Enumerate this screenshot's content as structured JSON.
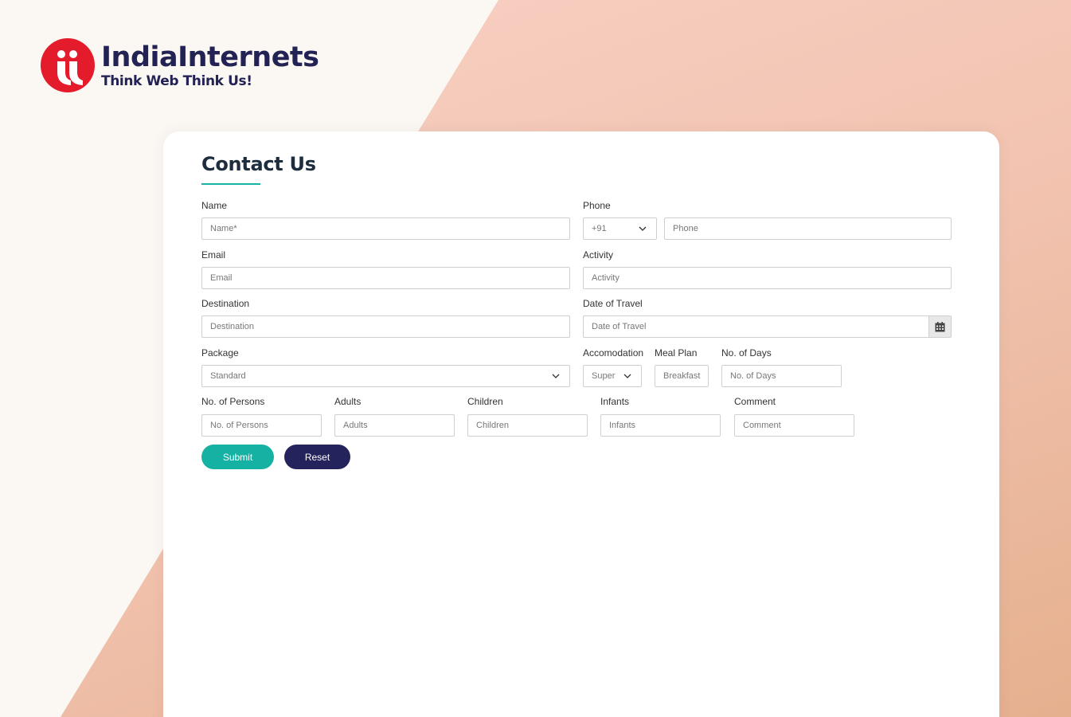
{
  "brand": {
    "name": "IndiaInternets",
    "tagline": "Think Web Think Us!",
    "logo_mark": "ii",
    "colors": {
      "red": "#e31b2b",
      "navy": "#222254",
      "teal": "#17b2a3"
    }
  },
  "form": {
    "title": "Contact Us",
    "name": {
      "label": "Name",
      "placeholder": "Name*"
    },
    "phone": {
      "label": "Phone",
      "code": "+91",
      "placeholder": "Phone"
    },
    "email": {
      "label": "Email",
      "placeholder": "Email"
    },
    "activity": {
      "label": "Activity",
      "placeholder": "Activity"
    },
    "destination": {
      "label": "Destination",
      "placeholder": "Destination"
    },
    "date": {
      "label": "Date of Travel",
      "placeholder": "Date of Travel",
      "icon": "calendar-icon"
    },
    "package": {
      "label": "Package",
      "value": "Standard"
    },
    "accommodation": {
      "label": "Accomodation",
      "value": "Super"
    },
    "meal_plan": {
      "label": "Meal Plan",
      "value": "Breakfast"
    },
    "days": {
      "label": "No. of Days",
      "placeholder": "No. of Days"
    },
    "persons": {
      "label": "No. of Persons",
      "placeholder": "No. of Persons"
    },
    "adults": {
      "label": "Adults",
      "placeholder": "Adults"
    },
    "children": {
      "label": "Children",
      "placeholder": "Children"
    },
    "infants": {
      "label": "Infants",
      "placeholder": "Infants"
    },
    "comment": {
      "label": "Comment",
      "placeholder": "Comment"
    },
    "submit_label": "Submit",
    "reset_label": "Reset",
    "submit_color": "#15b2a4",
    "reset_color": "#25235b"
  }
}
